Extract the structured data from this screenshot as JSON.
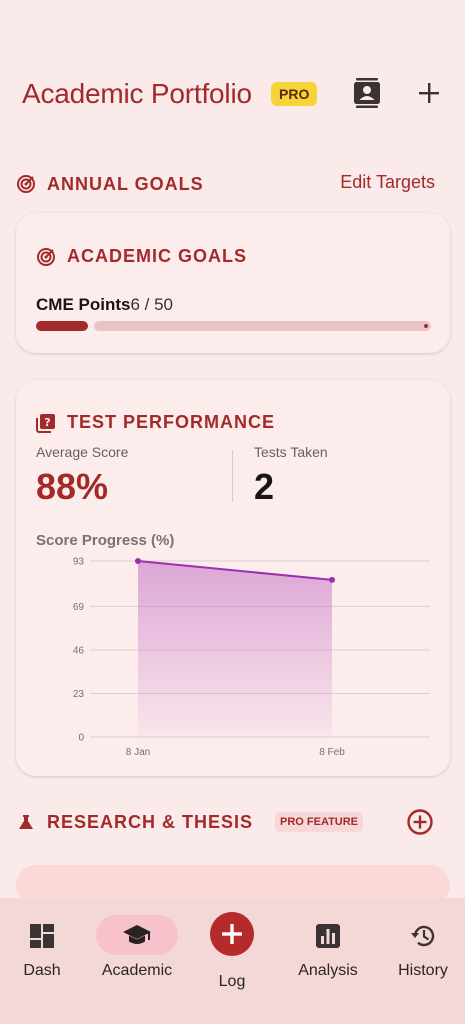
{
  "header": {
    "title": "Academic Portfolio",
    "pro_badge": "PRO",
    "icons": [
      "contacts-icon",
      "add-icon"
    ]
  },
  "annual_goals": {
    "title": "ANNUAL GOALS",
    "edit_label": "Edit Targets",
    "card": {
      "title": "ACADEMIC GOALS",
      "goal_name": "CME Points",
      "goal_progress": "6 / 50",
      "current": 6,
      "target": 50
    }
  },
  "test_performance": {
    "title": "TEST PERFORMANCE",
    "avg_label": "Average Score",
    "avg_value": "88%",
    "tests_label": "Tests Taken",
    "tests_value": "2",
    "chart_title": "Score Progress (%)"
  },
  "chart_data": {
    "type": "area",
    "title": "Score Progress (%)",
    "x": [
      "8 Jan",
      "8 Feb"
    ],
    "values": [
      93,
      83
    ],
    "yticks": [
      "93",
      "69",
      "46",
      "23",
      "0"
    ],
    "ylim": [
      0,
      93
    ],
    "grid": true,
    "color": "#9b30b0"
  },
  "research": {
    "title": "RESEARCH & THESIS",
    "badge": "PRO FEATURE"
  },
  "nav": {
    "items": [
      {
        "label": "Dash",
        "icon": "dashboard-icon"
      },
      {
        "label": "Academic",
        "icon": "graduation-cap-icon",
        "active": true
      },
      {
        "label": "Log",
        "icon": "plus-icon"
      },
      {
        "label": "Analysis",
        "icon": "bar-chart-icon"
      },
      {
        "label": "History",
        "icon": "history-icon"
      }
    ]
  },
  "colors": {
    "accent": "#a32a2a",
    "background": "#faeaea",
    "pro_badge": "#f7d33a",
    "chart_line": "#9b30b0"
  }
}
